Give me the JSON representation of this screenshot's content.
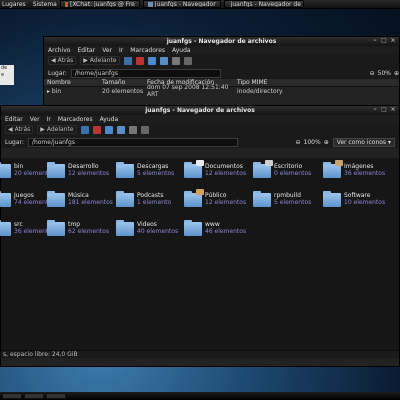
{
  "top_panel": {
    "menus": [
      "Lugares",
      "Sistema"
    ],
    "tasks": [
      {
        "label": "[XChat: juanfgs @ Fre",
        "icon": "xchat-icon"
      },
      {
        "label": "juanfgs - Navegador",
        "icon": "folder-icon"
      },
      {
        "label": "juanfgs - Navegador de",
        "icon": "folder-icon"
      }
    ]
  },
  "left_fragment": {
    "line1": "de",
    "line2": "e"
  },
  "back_window": {
    "title": "juanfgs - Navegador de archivos",
    "menu": [
      "Archivo",
      "Editar",
      "Ver",
      "Ir",
      "Marcadores",
      "Ayuda"
    ],
    "toolbar": {
      "back": "Atrás",
      "forward": "Adelante"
    },
    "location_label": "Lugar:",
    "location": "/home/juanfgs",
    "zoom": "50%",
    "columns": [
      "Nombre",
      "Tamaño",
      "Fecha de modificación",
      "Tipo MIME"
    ],
    "rows": [
      {
        "name": "bin",
        "size": "20 elementos",
        "date": "dom 07 sep 2008 12:51:40 ART",
        "type": "inode/directory"
      }
    ]
  },
  "front_window": {
    "title": "juanfgs - Navegador de archivos",
    "menu": [
      "Editar",
      "Ver",
      "Ir",
      "Marcadores",
      "Ayuda"
    ],
    "toolbar": {
      "back": "Atrás",
      "forward": "Adelante"
    },
    "location_label": "Lugar:",
    "location": "/home/juanfgs",
    "zoom": "100%",
    "view_select": "Ver como iconos",
    "status": "s, espacio libre: 24,0 GiB",
    "folders": [
      {
        "name": "bin",
        "count": "20 elementos",
        "badge": ""
      },
      {
        "name": "Desarrollo",
        "count": "12 elementos",
        "badge": ""
      },
      {
        "name": "Descargas",
        "count": "5 elementos",
        "badge": ""
      },
      {
        "name": "Documentos",
        "count": "12 elementos",
        "badge": "#e8e8e8"
      },
      {
        "name": "Escritorio",
        "count": "0 elementos",
        "badge": "#cfcfcf"
      },
      {
        "name": "Imágenes",
        "count": "36 elementos",
        "badge": "#c9a36b"
      },
      {
        "name": "Juegos",
        "count": "74 elementos",
        "badge": ""
      },
      {
        "name": "Música",
        "count": "181 elementos",
        "badge": ""
      },
      {
        "name": "Podcasts",
        "count": "1 elemento",
        "badge": ""
      },
      {
        "name": "Público",
        "count": "12 elementos",
        "badge": "#d2a25a"
      },
      {
        "name": "rpmbuild",
        "count": "5 elementos",
        "badge": ""
      },
      {
        "name": "Software",
        "count": "10 elementos",
        "badge": ""
      },
      {
        "name": "src",
        "count": "36 elementos",
        "badge": ""
      },
      {
        "name": "tmp",
        "count": "62 elementos",
        "badge": ""
      },
      {
        "name": "Videos",
        "count": "40 elementos",
        "badge": ""
      },
      {
        "name": "www",
        "count": "46 elementos",
        "badge": ""
      }
    ]
  }
}
